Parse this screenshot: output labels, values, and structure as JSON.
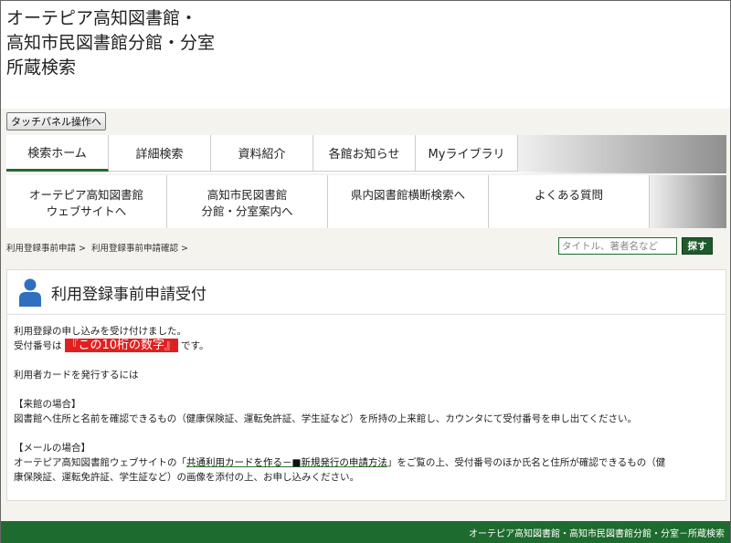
{
  "header": {
    "title_lines": [
      "オーテピア高知図書館・",
      "高知市民図書館分館・分室",
      "所蔵検索"
    ],
    "touch_button": "タッチパネル操作へ"
  },
  "nav_primary": [
    {
      "label": "検索ホーム",
      "active": true
    },
    {
      "label": "詳細検索"
    },
    {
      "label": "資料紹介"
    },
    {
      "label": "各館お知らせ"
    },
    {
      "label": "Myライブラリ"
    }
  ],
  "nav_secondary": [
    {
      "line1": "オーテピア高知図書館",
      "line2": "ウェブサイトへ"
    },
    {
      "line1": "高知市民図書館",
      "line2": "分館・分室案内へ"
    },
    {
      "line1": "県内図書館横断検索へ",
      "line2": ""
    },
    {
      "line1": "よくある質問",
      "line2": ""
    }
  ],
  "breadcrumb": [
    "利用登録事前申請 >",
    "利用登録事前申請確認 >"
  ],
  "search": {
    "placeholder": "タイトル、著者名など",
    "button": "探す"
  },
  "panel": {
    "title": "利用登録事前申請受付",
    "line1": "利用登録の申し込みを受け付けました。",
    "line2_prefix": "受付番号は",
    "line2_highlight": "『この10桁の数字』",
    "line2_suffix": "です。",
    "line3": "利用者カードを発行するには",
    "visit_head": "【来館の場合】",
    "visit_text": "図書館へ住所と名前を確認できるもの（健康保険証、運転免許証、学生証など）を所持の上来館し、カウンタにて受付番号を申し出てください。",
    "mail_head": "【メールの場合】",
    "mail_prefix": "オーテピア高知図書館ウェブサイトの「",
    "mail_link": "共通利用カードを作る－■新規発行の申請方法",
    "mail_suffix": "」をご覧の上、受付番号のほか氏名と住所が確認できるもの（健",
    "mail_line2": "康保険証、運転免許証、学生証など）の画像を添付の上、お申し込みください。"
  },
  "footer": {
    "text": "オーテピア高知図書館・高知市民図書館分館・分室－所蔵検索"
  },
  "colors": {
    "brand_green": "#1e6b2f",
    "highlight_red": "#e02020",
    "icon_blue": "#2f6fbf"
  }
}
